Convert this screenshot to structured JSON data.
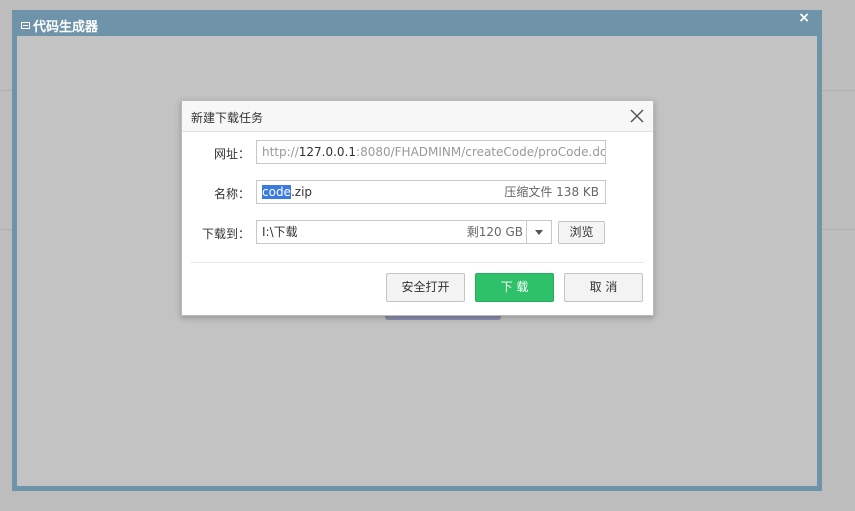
{
  "generator": {
    "title": "代码生成器",
    "close_glyph": "×"
  },
  "dialog": {
    "title": "新建下载任务",
    "url_label": "网址：",
    "url_prefix": "http://",
    "url_host": "127.0.0.1",
    "url_rest": ":8080/FHADMINM/createCode/proCode.dc",
    "name_label": "名称：",
    "name_selected": "code",
    "name_rest": ".zip",
    "file_type": "压缩文件",
    "file_size": "138 KB",
    "save_label": "下载到：",
    "save_path": "I:\\下载",
    "free_space": "剩120 GB",
    "browse_label": "浏览",
    "safe_open_label": "安全打开",
    "download_label": "下 载",
    "cancel_label": "取 消"
  },
  "colors": {
    "generator_frame": "#6f93a8",
    "download_button": "#2fc06a",
    "selection": "#3b7ae0"
  }
}
